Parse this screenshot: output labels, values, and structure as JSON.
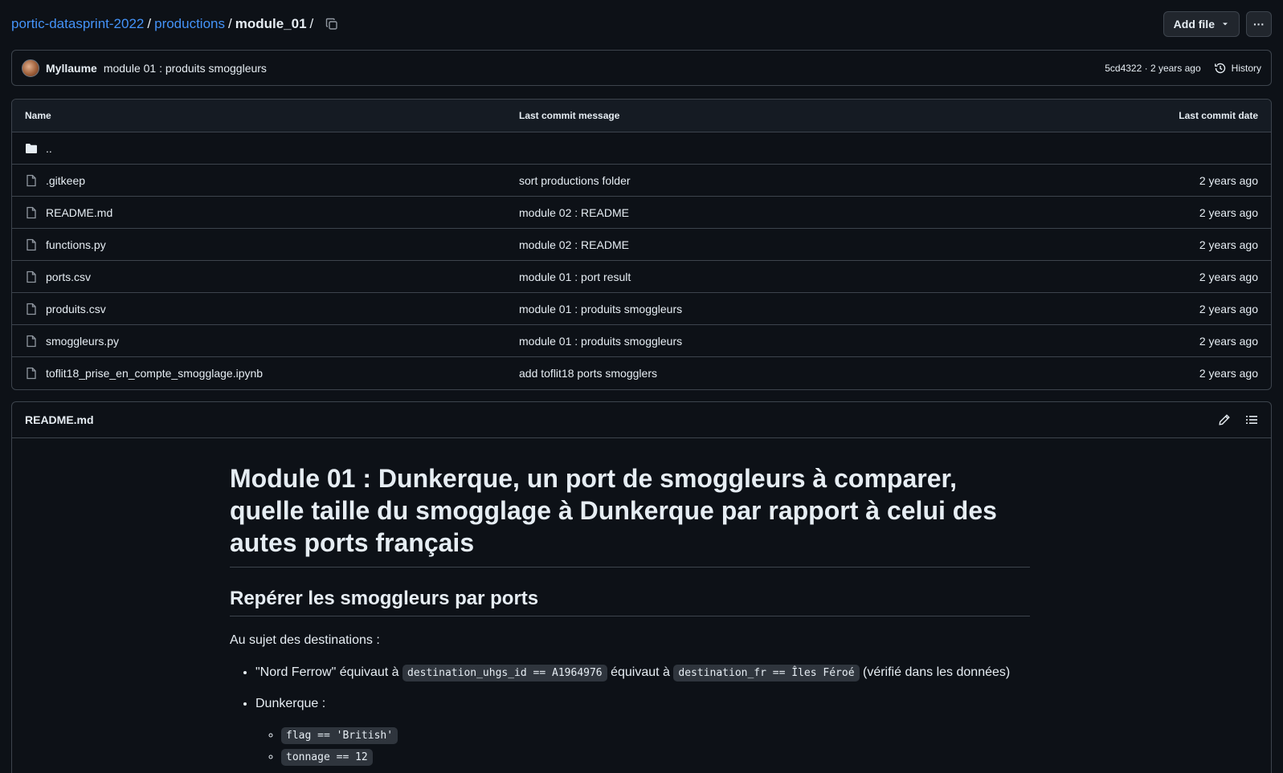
{
  "breadcrumb": {
    "repo": "portic-datasprint-2022",
    "folder": "productions",
    "current": "module_01",
    "trailing_sep": "/"
  },
  "toolbar": {
    "add_file_label": "Add file",
    "more_label": "···"
  },
  "latest_commit": {
    "author": "Myllaume",
    "message": "module 01 : produits smoggleurs",
    "sha_time": "5cd4322 · 2 years ago",
    "history_label": "History"
  },
  "file_table": {
    "headers": {
      "name": "Name",
      "message": "Last commit message",
      "date": "Last commit date"
    },
    "parent_label": "..",
    "rows": [
      {
        "name": ".gitkeep",
        "message": "sort productions folder",
        "date": "2 years ago"
      },
      {
        "name": "README.md",
        "message": "module 02 : README",
        "date": "2 years ago"
      },
      {
        "name": "functions.py",
        "message": "module 02 : README",
        "date": "2 years ago"
      },
      {
        "name": "ports.csv",
        "message": "module 01 : port result",
        "date": "2 years ago"
      },
      {
        "name": "produits.csv",
        "message": "module 01 : produits smoggleurs",
        "date": "2 years ago"
      },
      {
        "name": "smoggleurs.py",
        "message": "module 01 : produits smoggleurs",
        "date": "2 years ago"
      },
      {
        "name": "toflit18_prise_en_compte_smogglage.ipynb",
        "message": "add toflit18 ports smogglers",
        "date": "2 years ago"
      }
    ]
  },
  "readme": {
    "filename": "README.md",
    "h1": "Module 01 : Dunkerque, un port de smoggleurs à comparer, quelle taille du smogglage à Dunkerque par rapport à celui des autes ports français",
    "h2": "Repérer les smoggleurs par ports",
    "intro": "Au sujet des destinations :",
    "li1_text1": "\"Nord Ferrow\" équivaut à",
    "li1_code1": "destination_uhgs_id == A1964976",
    "li1_text2": "équivaut à",
    "li1_code2": "destination_fr == Îles Féroé",
    "li1_text3": "(vérifié dans les données)",
    "li2_text": "Dunkerque :",
    "sub_code1": "flag == 'British'",
    "sub_code2": "tonnage == 12"
  }
}
